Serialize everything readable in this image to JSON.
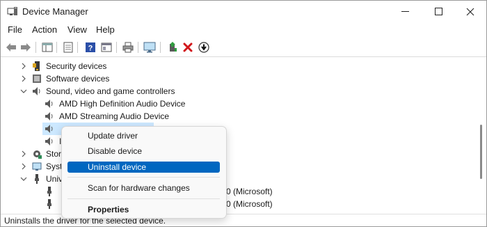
{
  "window": {
    "title": "Device Manager"
  },
  "menubar": {
    "items": [
      "File",
      "Action",
      "View",
      "Help"
    ]
  },
  "tree": {
    "rows": [
      {
        "label": "Security devices"
      },
      {
        "label": "Software devices"
      },
      {
        "label": "Sound, video and game controllers"
      },
      {
        "label": "AMD High Definition Audio Device"
      },
      {
        "label": "AMD Streaming Audio Device"
      },
      {
        "label": ""
      },
      {
        "label": "I"
      },
      {
        "label": "Stor"
      },
      {
        "label": "Syst"
      },
      {
        "label": "Univ"
      },
      {
        "label": "0 (Microsoft)"
      },
      {
        "label": "0 (Microsoft)"
      }
    ]
  },
  "context_menu": {
    "items": [
      {
        "label": "Update driver"
      },
      {
        "label": "Disable device"
      },
      {
        "label": "Uninstall device"
      },
      {
        "label": "Scan for hardware changes"
      },
      {
        "label": "Properties"
      }
    ]
  },
  "status": {
    "text": "Uninstalls the driver for the selected device."
  },
  "colors": {
    "highlight": "#0067c0",
    "selection": "#cce8ff"
  }
}
